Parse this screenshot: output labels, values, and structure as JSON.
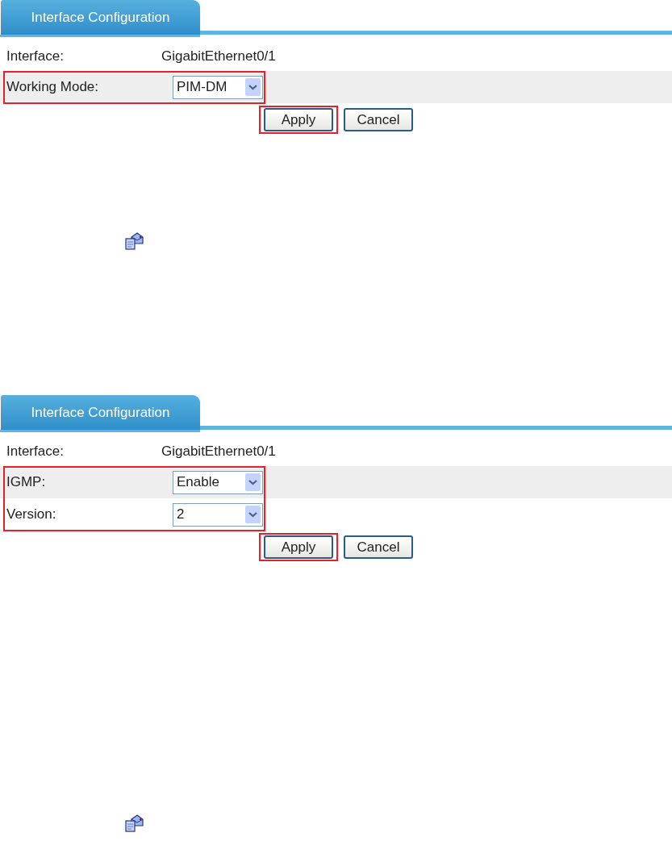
{
  "sections": [
    {
      "tab": {
        "label": "Interface Configuration",
        "selected": true
      },
      "interface": {
        "label": "Interface:",
        "value": "GigabitEthernet0/1"
      },
      "fields": [
        {
          "label": "Working Mode:",
          "value": "PIM-DM",
          "shaded": true
        }
      ],
      "fields_highlighted": true,
      "buttons": [
        {
          "label": "Apply",
          "highlighted": true
        },
        {
          "label": "Cancel",
          "highlighted": false
        }
      ]
    },
    {
      "tab": {
        "label": "Interface Configuration",
        "selected": true
      },
      "interface": {
        "label": "Interface:",
        "value": "GigabitEthernet0/1"
      },
      "fields": [
        {
          "label": "IGMP:",
          "value": "Enable",
          "shaded": true
        },
        {
          "label": "Version:",
          "value": "2",
          "shaded": false
        }
      ],
      "fields_highlighted": true,
      "buttons": [
        {
          "label": "Apply",
          "highlighted": true
        },
        {
          "label": "Cancel",
          "highlighted": false
        }
      ]
    }
  ]
}
